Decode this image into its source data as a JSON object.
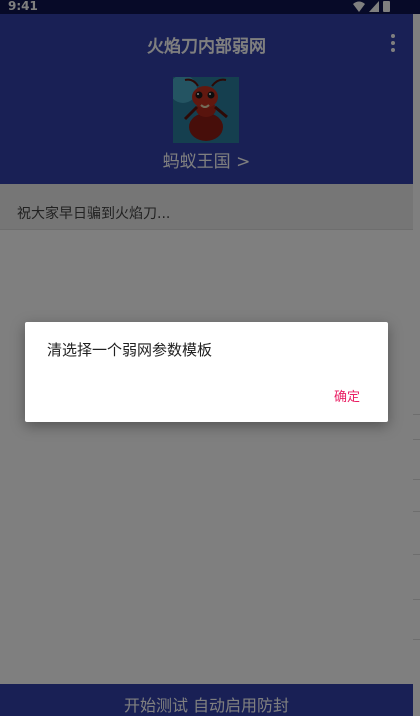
{
  "status_bar": {
    "time": "9:41"
  },
  "app_bar": {
    "title": "火焰刀内部弱网",
    "profile_name": "蚂蚁王国 >"
  },
  "banner": {
    "text": "祝大家早日骗到火焰刀..."
  },
  "bottom_button": {
    "label": "开始测试 自动启用防封"
  },
  "dialog": {
    "message": "清选择一个弱网参数模板",
    "ok_label": "确定"
  },
  "colors": {
    "primary": "#3340ab",
    "status_bar": "#0e1550",
    "accent": "#e91e63"
  }
}
